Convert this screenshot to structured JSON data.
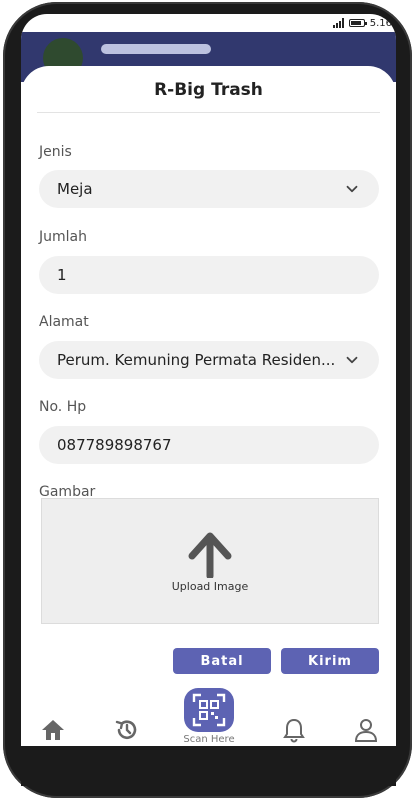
{
  "status_bar": {
    "time": "5.16"
  },
  "sheet": {
    "title": "R-Big Trash",
    "fields": {
      "jenis": {
        "label": "Jenis",
        "value": "Meja"
      },
      "jumlah": {
        "label": "Jumlah",
        "value": "1"
      },
      "alamat": {
        "label": "Alamat",
        "value": "Perum. Kemuning Permata Residen..."
      },
      "no_hp": {
        "label": "No. Hp",
        "value": "087789898767"
      },
      "gambar": {
        "label": "Gambar",
        "upload_label": "Upload Image"
      }
    },
    "buttons": {
      "cancel": "Batal",
      "submit": "Kirim"
    }
  },
  "bottom_nav": {
    "items": [
      "home-icon",
      "history-icon",
      "qr-scan-icon",
      "bell-icon",
      "user-icon"
    ],
    "scan_label": "Scan Here"
  },
  "colors": {
    "accent": "#5d63b3",
    "header": "#31386e"
  }
}
